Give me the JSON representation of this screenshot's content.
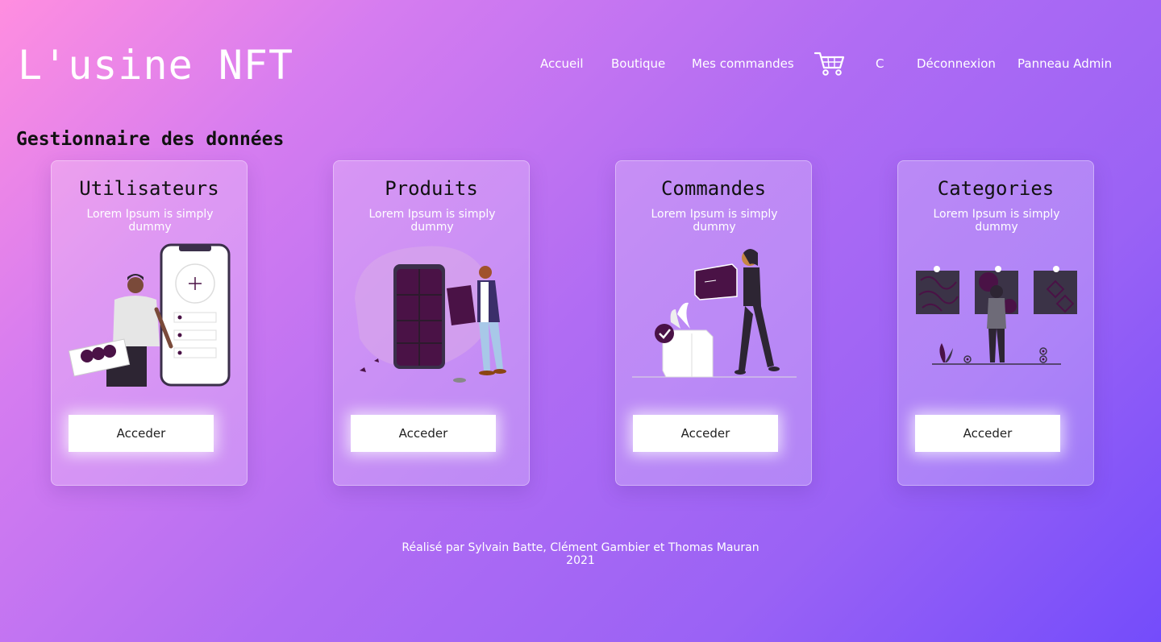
{
  "app": {
    "logo": "L'usine NFT"
  },
  "nav": {
    "items": [
      "Accueil",
      "Boutique",
      "Mes commandes",
      "C",
      "Déconnexion",
      "Panneau Admin"
    ],
    "cart_icon": "cart-icon"
  },
  "section": {
    "title": "Gestionnaire des données"
  },
  "cards": [
    {
      "title": "Utilisateurs",
      "desc": "Lorem Ipsum is simply dummy",
      "button": "Acceder",
      "illustration": "users-illustration"
    },
    {
      "title": "Produits",
      "desc": "Lorem Ipsum is simply dummy",
      "button": "Acceder",
      "illustration": "puzzle-phone-illustration"
    },
    {
      "title": "Commandes",
      "desc": "Lorem Ipsum is simply dummy",
      "button": "Acceder",
      "illustration": "delivery-box-illustration"
    },
    {
      "title": "Categories",
      "desc": "Lorem Ipsum is simply dummy",
      "button": "Acceder",
      "illustration": "gallery-illustration"
    }
  ],
  "footer": {
    "credits": "Réalisé par Sylvain Batte, Clément Gambier et Thomas Mauran",
    "year": "2021"
  },
  "colors": {
    "accent_dark": "#4a1246",
    "gradient_start": "#ff8ee0",
    "gradient_end": "#744cfb"
  }
}
